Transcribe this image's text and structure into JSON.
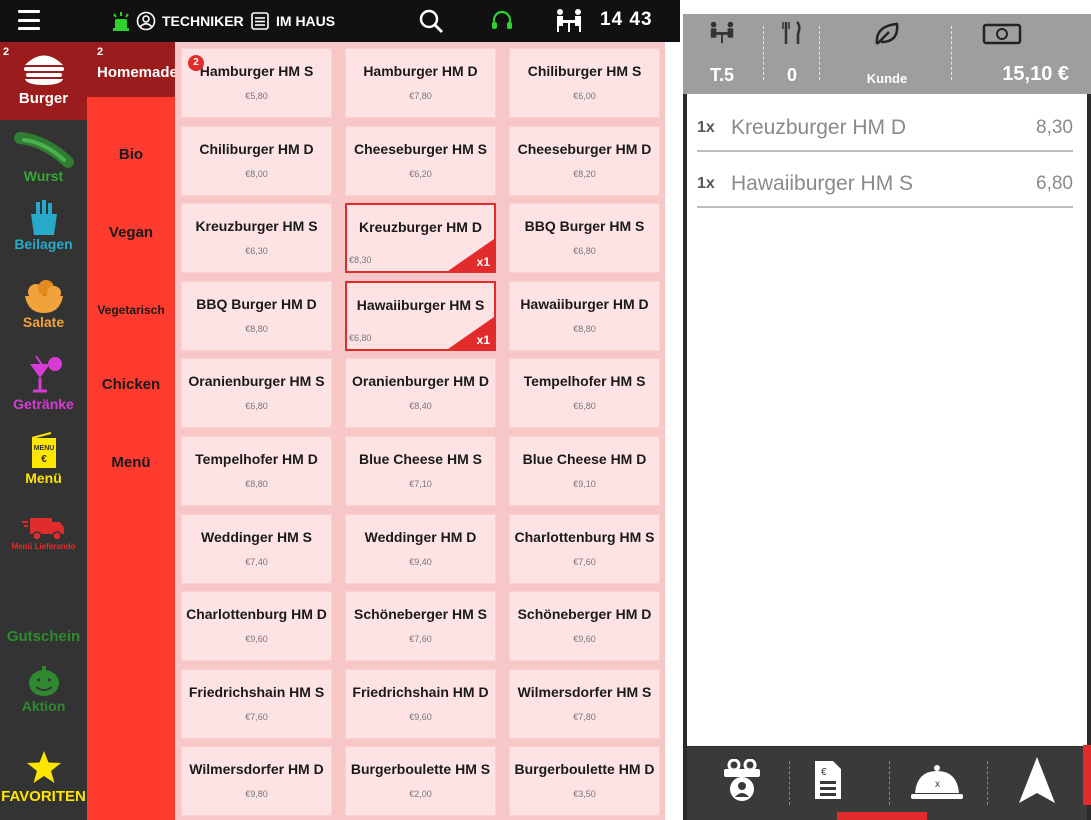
{
  "topbar": {
    "techniker_label": "TECHNIKER",
    "imhaus_label": "IM HAUS",
    "time": "14 43"
  },
  "categories": [
    {
      "label": "Burger",
      "badge": "2",
      "icon": "burger-icon",
      "color": "#ffffff"
    },
    {
      "label": "Wurst",
      "icon": "sausage-icon",
      "color": "#3aa635"
    },
    {
      "label": "Beilagen",
      "icon": "fries-icon",
      "color": "#27a9c9"
    },
    {
      "label": "Salate",
      "icon": "salad-bowl-icon",
      "color": "#f2a23a"
    },
    {
      "label": "Getränke",
      "icon": "cocktail-icon",
      "color": "#d63bd6"
    },
    {
      "label": "Menü",
      "icon": "menu-board-icon",
      "color": "#ffe600",
      "icon_text": "MENU €"
    },
    {
      "label": "Menü Lieferando",
      "icon": "delivery-truck-icon",
      "color": "#e22b2b"
    },
    {
      "label": "Gutschein",
      "color": "#2f8a2f"
    },
    {
      "label": "Aktion",
      "icon": "pumpkin-icon",
      "color": "#2f8a2f"
    },
    {
      "label": "FAVORITEN",
      "icon": "star-icon",
      "color": "#ffe600"
    }
  ],
  "subcategories": [
    {
      "label": "Homemade",
      "badge": "2"
    },
    {
      "label": "Bio"
    },
    {
      "label": "Vegan"
    },
    {
      "label": "Vegetarisch"
    },
    {
      "label": "Chicken"
    },
    {
      "label": "Menü"
    }
  ],
  "products": [
    {
      "name": "Hamburger HM S",
      "price": "€5,80",
      "badge": "2"
    },
    {
      "name": "Hamburger HM D",
      "price": "€7,80"
    },
    {
      "name": "Chiliburger HM S",
      "price": "€6,00"
    },
    {
      "name": "Chiliburger HM D",
      "price": "€8,00"
    },
    {
      "name": "Cheeseburger HM S",
      "price": "€6,20"
    },
    {
      "name": "Cheeseburger HM D",
      "price": "€8,20"
    },
    {
      "name": "Kreuzburger HM S",
      "price": "€6,30"
    },
    {
      "name": "Kreuzburger HM D",
      "price": "€8,30",
      "selected": true,
      "qty": "x1"
    },
    {
      "name": "BBQ Burger HM S",
      "price": "€6,80"
    },
    {
      "name": "BBQ Burger HM D",
      "price": "€8,80"
    },
    {
      "name": "Hawaiiburger HM S",
      "price": "€6,80",
      "selected": true,
      "qty": "x1"
    },
    {
      "name": "Hawaiiburger HM D",
      "price": "€8,80"
    },
    {
      "name": "Oranienburger HM S",
      "price": "€6,80"
    },
    {
      "name": "Oranienburger HM D",
      "price": "€8,40"
    },
    {
      "name": "Tempelhofer HM S",
      "price": "€6,80"
    },
    {
      "name": "Tempelhofer HM D",
      "price": "€8,80"
    },
    {
      "name": "Blue Cheese HM S",
      "price": "€7,10"
    },
    {
      "name": "Blue Cheese HM D",
      "price": "€9,10"
    },
    {
      "name": "Weddinger HM S",
      "price": "€7,40"
    },
    {
      "name": "Weddinger HM D",
      "price": "€9,40"
    },
    {
      "name": "Charlottenburg HM S",
      "price": "€7,60"
    },
    {
      "name": "Charlottenburg HM D",
      "price": "€9,60"
    },
    {
      "name": "Schöneberger HM S",
      "price": "€7,60"
    },
    {
      "name": "Schöneberger HM D",
      "price": "€9,60"
    },
    {
      "name": "Friedrichshain HM S",
      "price": "€7,60"
    },
    {
      "name": "Friedrichshain HM D",
      "price": "€9,60"
    },
    {
      "name": "Wilmersdorfer HM S",
      "price": "€7,80"
    },
    {
      "name": "Wilmersdorfer HM D",
      "price": "€9,80"
    },
    {
      "name": "Burgerboulette HM S",
      "price": "€2,00"
    },
    {
      "name": "Burgerboulette HM D",
      "price": "€3,50"
    }
  ],
  "order": {
    "table": "T.5",
    "guests": "0",
    "customer": "Kunde",
    "total": "15,10 €",
    "items": [
      {
        "qty": "1x",
        "name": "Kreuzburger HM D",
        "price": "8,30"
      },
      {
        "qty": "1x",
        "name": "Hawaiiburger HM S",
        "price": "6,80"
      }
    ]
  },
  "colors": {
    "accent_red": "#e22b2b",
    "dark_red": "#9b1c1c",
    "sub_red": "#ff3b30",
    "tile_pink": "#fde3e3",
    "panel_grey": "#9e9e9e"
  }
}
